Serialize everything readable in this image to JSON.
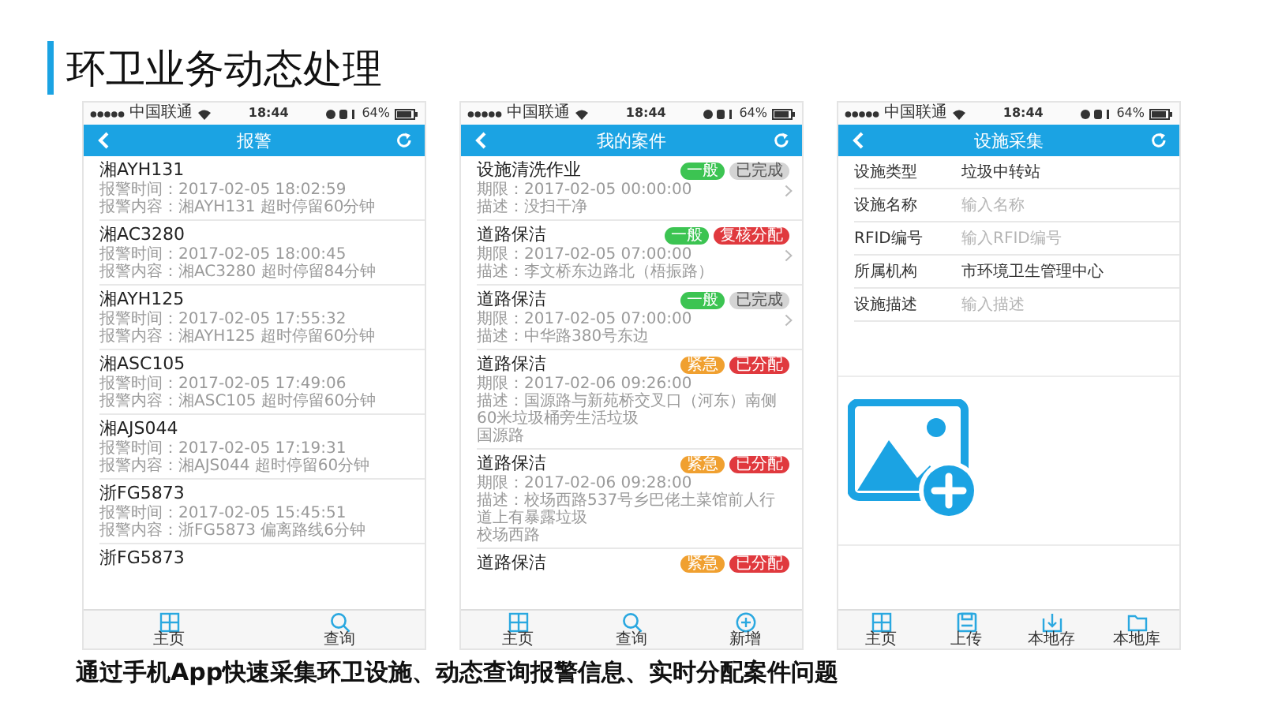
{
  "title": "环卫业务动态处理",
  "phones": [
    {
      "kind": "alarms",
      "status_bar": {
        "carrier": "中国联通",
        "time": "18:44",
        "battery": "64%"
      },
      "nav_title": "报警",
      "items": [
        {
          "title": "湘AYH131",
          "lines": [
            "报警时间：2017-02-05 18:02:59",
            "报警内容：湘AYH131 超时停留60分钟"
          ]
        },
        {
          "title": "湘AC3280",
          "lines": [
            "报警时间：2017-02-05 18:00:45",
            "报警内容：湘AC3280 超时停留84分钟"
          ]
        },
        {
          "title": "湘AYH125",
          "lines": [
            "报警时间：2017-02-05 17:55:32",
            "报警内容：湘AYH125 超时停留60分钟"
          ]
        },
        {
          "title": "湘ASC105",
          "lines": [
            "报警时间：2017-02-05 17:49:06",
            "报警内容：湘ASC105 超时停留60分钟"
          ]
        },
        {
          "title": "湘AJS044",
          "lines": [
            "报警时间：2017-02-05 17:19:31",
            "报警内容：湘AJS044 超时停留60分钟"
          ]
        },
        {
          "title": "浙FG5873",
          "lines": [
            "报警时间：2017-02-05 15:45:51",
            "报警内容：浙FG5873 偏离路线6分钟"
          ]
        },
        {
          "title": "浙FG5873"
        }
      ],
      "tabs": [
        {
          "label": "主页",
          "kind": "grid"
        },
        {
          "label": "查询",
          "kind": "search"
        }
      ]
    },
    {
      "kind": "cases",
      "status_bar": {
        "carrier": "中国联通",
        "time": "18:44",
        "battery": "64%"
      },
      "nav_title": "我的案件",
      "items": [
        {
          "title": "设施清洗作业",
          "arrow": true,
          "badges": [
            {
              "label": "一般",
              "color": "#3cc452"
            },
            {
              "label": "已完成",
              "color": "#d4d4d4"
            }
          ],
          "lines": [
            "期限：2017-02-05 00:00:00",
            "描述：没扫干净"
          ]
        },
        {
          "title": "道路保洁",
          "arrow": true,
          "badges": [
            {
              "label": "一般",
              "color": "#3cc452"
            },
            {
              "label": "复核分配",
              "color": "#e0393e"
            }
          ],
          "lines": [
            "期限：2017-02-05 07:00:00",
            "描述：李文桥东边路北（梧振路）"
          ]
        },
        {
          "title": "道路保洁",
          "arrow": true,
          "badges": [
            {
              "label": "一般",
              "color": "#3cc452"
            },
            {
              "label": "已完成",
              "color": "#d4d4d4"
            }
          ],
          "lines": [
            "期限：2017-02-05 07:00:00",
            "描述：中华路380号东边"
          ]
        },
        {
          "title": "道路保洁",
          "arrow": false,
          "badges": [
            {
              "label": "紧急",
              "color": "#f0a030"
            },
            {
              "label": "已分配",
              "color": "#e0393e"
            }
          ],
          "lines": [
            "期限：2017-02-06 09:26:00",
            "描述：国源路与新苑桥交叉口（河东）南侧60米垃圾桶旁生活垃圾",
            "国源路"
          ]
        },
        {
          "title": "道路保洁",
          "arrow": false,
          "badges": [
            {
              "label": "紧急",
              "color": "#f0a030"
            },
            {
              "label": "已分配",
              "color": "#e0393e"
            }
          ],
          "lines": [
            "期限：2017-02-06 09:28:00",
            "描述：校场西路537号乡巴佬土菜馆前人行道上有暴露垃圾",
            "校场西路"
          ]
        },
        {
          "title": "道路保洁",
          "arrow": false,
          "badges": [
            {
              "label": "紧急",
              "color": "#f0a030"
            },
            {
              "label": "已分配",
              "color": "#e0393e"
            }
          ]
        }
      ],
      "tabs": [
        {
          "label": "主页",
          "kind": "grid"
        },
        {
          "label": "查询",
          "kind": "search"
        },
        {
          "label": "新增",
          "kind": "add"
        }
      ]
    },
    {
      "kind": "form",
      "status_bar": {
        "carrier": "中国联通",
        "time": "18:44",
        "battery": "64%"
      },
      "nav_title": "设施采集",
      "fields": [
        {
          "label": "设施类型",
          "value": "垃圾中转站"
        },
        {
          "label": "设施名称",
          "placeholder": "输入名称"
        },
        {
          "label": "RFID编号",
          "placeholder": "输入RFID编号"
        },
        {
          "label": "所属机构",
          "value": "市环境卫生管理中心"
        },
        {
          "label": "设施描述",
          "placeholder": "输入描述"
        }
      ],
      "tabs": [
        {
          "label": "主页",
          "kind": "grid"
        },
        {
          "label": "上传",
          "kind": "save"
        },
        {
          "label": "本地存",
          "kind": "download"
        },
        {
          "label": "本地库",
          "kind": "folder"
        }
      ]
    }
  ],
  "caption": "通过手机App快速采集环卫设施、动态查询报警信息、实时分配案件问题"
}
